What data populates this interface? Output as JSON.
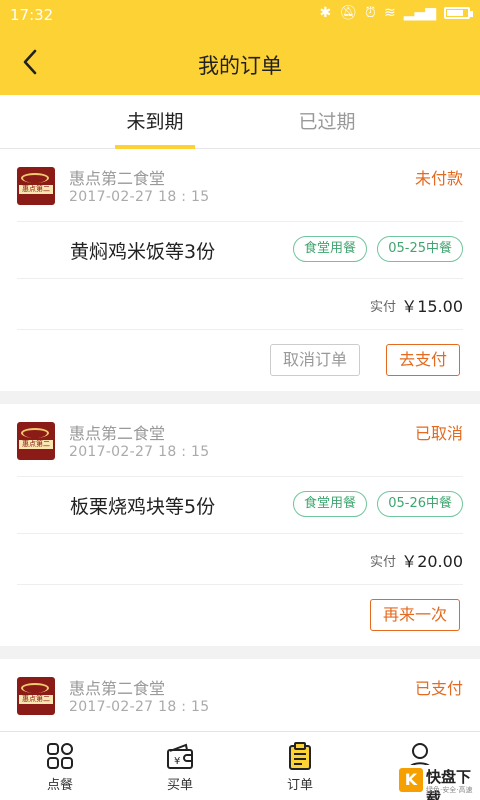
{
  "status_bar": {
    "time": "17:32"
  },
  "header": {
    "title": "我的订单"
  },
  "tabs": [
    {
      "label": "未到期",
      "active": true
    },
    {
      "label": "已过期",
      "active": false
    }
  ],
  "orders": [
    {
      "store": "惠点第二食堂",
      "time": "2017-02-27 18 : 15",
      "status": "未付款",
      "item": "黄焖鸡米饭等3份",
      "tags": [
        "食堂用餐",
        "05-25中餐"
      ],
      "amount_label": "实付",
      "amount": "￥15.00",
      "actions": [
        "取消订单",
        "去支付"
      ]
    },
    {
      "store": "惠点第二食堂",
      "time": "2017-02-27 18 : 15",
      "status": "已取消",
      "item": "板栗烧鸡块等5份",
      "tags": [
        "食堂用餐",
        "05-26中餐"
      ],
      "amount_label": "实付",
      "amount": "￥20.00",
      "actions": [
        "再来一次"
      ]
    },
    {
      "store": "惠点第二食堂",
      "time": "2017-02-27 18 : 15",
      "status": "已支付"
    }
  ],
  "bottom_nav": [
    {
      "label": "点餐",
      "icon": "grid-icon"
    },
    {
      "label": "买单",
      "icon": "wallet-icon"
    },
    {
      "label": "订单",
      "icon": "clipboard-icon"
    },
    {
      "label": "",
      "icon": "person-icon"
    }
  ],
  "logo_text": "惠点第二食堂",
  "watermark": {
    "text": "快盘下载",
    "sub": "绿色·安全·高速"
  },
  "colors": {
    "accent": "#fdd235",
    "status": "#e36a1f",
    "tag": "#3fa56f"
  }
}
